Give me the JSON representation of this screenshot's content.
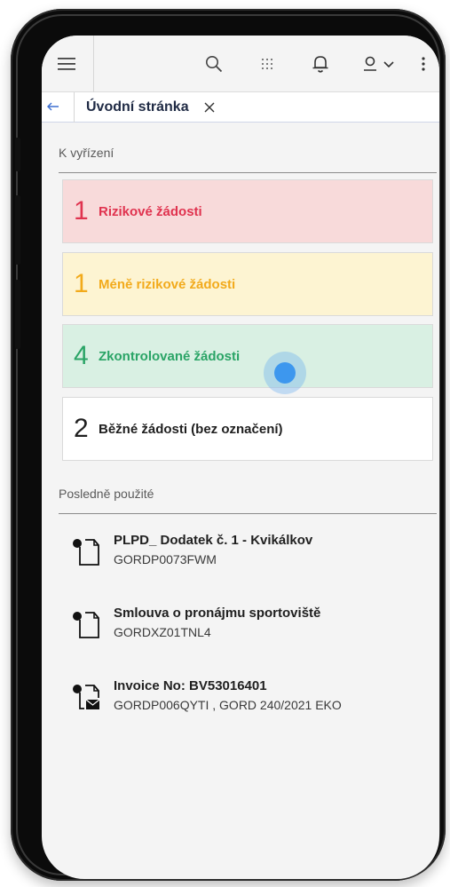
{
  "header": {
    "icons": [
      "menu-icon",
      "search-icon",
      "apps-grid-icon",
      "bell-icon",
      "user-icon",
      "chevron-down-icon",
      "more-vertical-icon"
    ]
  },
  "tab": {
    "title": "Úvodní stránka",
    "back_icon": "arrow-left-icon",
    "close_icon": "close-icon"
  },
  "sections": {
    "pending_title": "K vyřízení",
    "recent_title": "Posledně použité"
  },
  "cards": [
    {
      "count": "1",
      "label": "Rizikové žádosti",
      "color": "#e0334f"
    },
    {
      "count": "1",
      "label": "Méně rizikové žádosti",
      "color": "#f2aa1b"
    },
    {
      "count": "4",
      "label": "Zkontrolované žádosti",
      "color": "#2aa466"
    },
    {
      "count": "2",
      "label": "Běžné žádosti (bez označení)",
      "color": "#1f1f1f"
    }
  ],
  "recent": [
    {
      "title": "PLPD_ Dodatek č. 1 - Kvikálkov",
      "code": "GORDP0073FWM",
      "icon": "document-icon"
    },
    {
      "title": "Smlouva o pronájmu sportoviště",
      "code": "GORDXZ01TNL4",
      "icon": "document-icon"
    },
    {
      "title": "Invoice No: BV53016401",
      "code": "GORDP006QYTI , GORD 240/2021 EKO",
      "icon": "document-mail-icon"
    }
  ]
}
